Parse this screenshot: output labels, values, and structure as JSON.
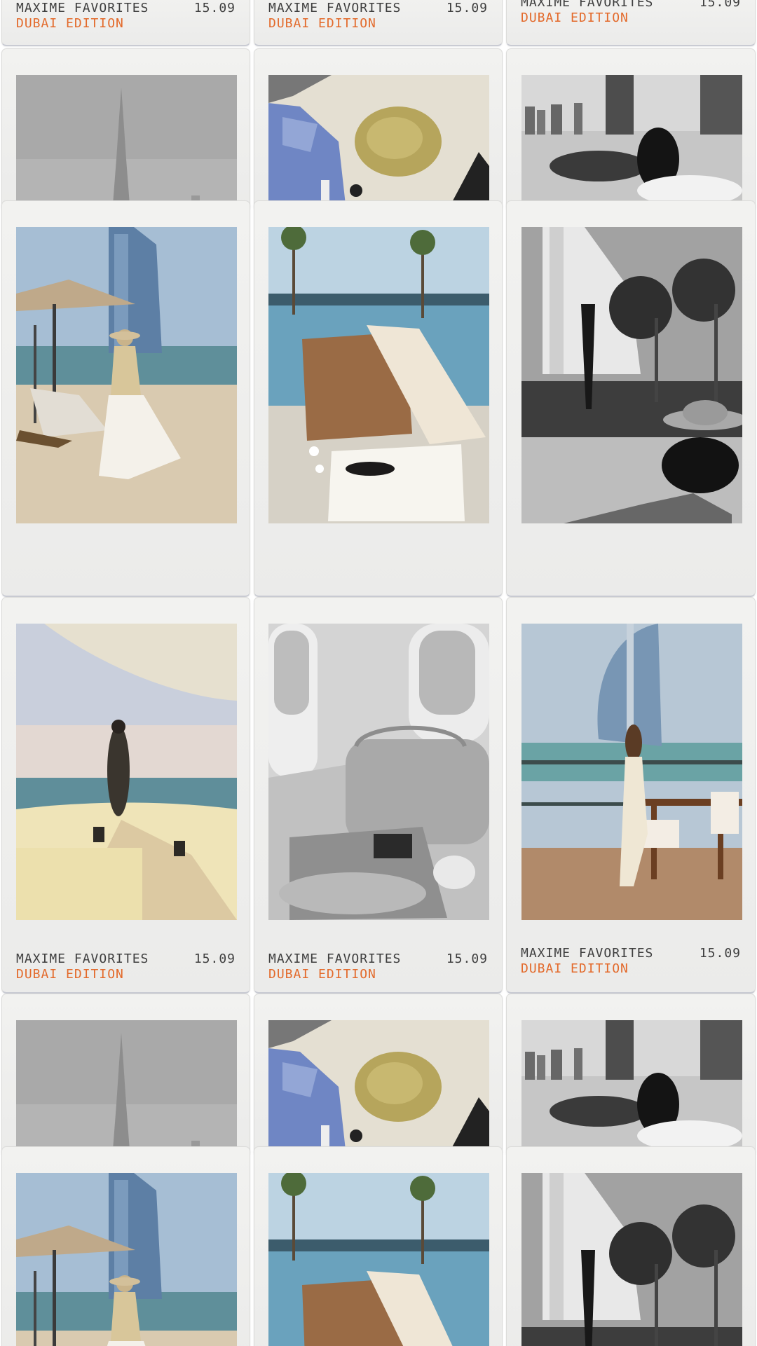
{
  "caption": {
    "title": "MAXIME FAVORITES",
    "date": "15.09",
    "edition": "DUBAI EDITION"
  },
  "colors": {
    "card": "#efefed",
    "caption_text": "#3f3f3f",
    "edition_text": "#e36a2b"
  },
  "photos": [
    {
      "id": "burj-khalifa-bw",
      "name": "burj-khalifa-photo"
    },
    {
      "id": "straw-bag-car",
      "name": "straw-bag-photo"
    },
    {
      "id": "skyline-woman-bw",
      "name": "skyline-woman-photo"
    },
    {
      "id": "burj-al-arab-beach",
      "name": "beach-umbrella-photo"
    },
    {
      "id": "pool-bag-book",
      "name": "pool-bag-photo"
    },
    {
      "id": "palms-hat-bw",
      "name": "palms-hat-photo"
    },
    {
      "id": "terrace-woman",
      "name": "terrace-woman-photo"
    },
    {
      "id": "plane-bag-bw",
      "name": "plane-bag-photo"
    },
    {
      "id": "burj-al-arab-terrace",
      "name": "burj-terrace-photo"
    }
  ]
}
